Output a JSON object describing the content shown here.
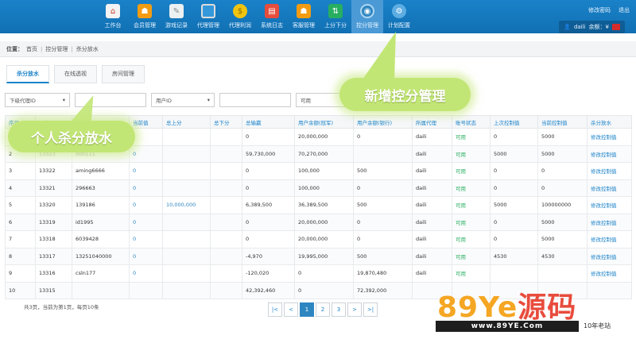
{
  "nav": {
    "items": [
      {
        "label": "工作台",
        "icon": "home-icon",
        "glyph": "⌂"
      },
      {
        "label": "会员管理",
        "icon": "users-icon",
        "glyph": "☗"
      },
      {
        "label": "游戏记录",
        "icon": "record-icon",
        "glyph": "✎"
      },
      {
        "label": "代理管理",
        "icon": "monitor-icon",
        "glyph": "▭"
      },
      {
        "label": "代理利润",
        "icon": "money-bag-icon",
        "glyph": "$"
      },
      {
        "label": "系统日志",
        "icon": "log-icon",
        "glyph": "▤"
      },
      {
        "label": "客服管理",
        "icon": "service-icon",
        "glyph": "☗"
      },
      {
        "label": "上分下分",
        "icon": "transfer-icon",
        "glyph": "⇅"
      },
      {
        "label": "控分管理",
        "icon": "control-icon",
        "glyph": "◉"
      },
      {
        "label": "计划配置",
        "icon": "config-icon",
        "glyph": "⚙"
      }
    ],
    "active_index": 8
  },
  "top_right": {
    "change_password": "修改密码",
    "logout": "退出"
  },
  "user": {
    "name": "daili",
    "balance_label": "余额：¥"
  },
  "breadcrumb": {
    "prefix": "位置：",
    "items": [
      "首页",
      "控分管理",
      "杀分放水"
    ]
  },
  "tabs": [
    "杀分放水",
    "在线透视",
    "房间管理"
  ],
  "filters": {
    "agent_select": "下级代理ID",
    "user_select": "用户ID",
    "status_select": "可用"
  },
  "table": {
    "headers": [
      "序号",
      "玩家ID",
      "玩家账号",
      "当前值",
      "总上分",
      "总下分",
      "总输赢",
      "用户余额(冠军)",
      "用户余额(银行)",
      "所属代理",
      "账号状态",
      "上次控制值",
      "当前控制值",
      "杀分放水"
    ],
    "rows": [
      [
        "1",
        "13324",
        "",
        "",
        "",
        "",
        "0",
        "20,000,000",
        "0",
        "daili",
        "可用",
        "0",
        "5000",
        "修改控制值"
      ],
      [
        "2",
        "13323",
        "000111",
        "0",
        "",
        "",
        "59,730,000",
        "70,270,000",
        "",
        "daili",
        "可用",
        "5000",
        "5000",
        "修改控制值"
      ],
      [
        "3",
        "13322",
        "aming6666",
        "0",
        "",
        "",
        "0",
        "100,000",
        "500",
        "daili",
        "可用",
        "0",
        "0",
        "修改控制值"
      ],
      [
        "4",
        "13321",
        "296663",
        "0",
        "",
        "",
        "0",
        "100,000",
        "0",
        "daili",
        "可用",
        "0",
        "0",
        "修改控制值"
      ],
      [
        "5",
        "13320",
        "139186",
        "0",
        "10,000,000",
        "",
        "6,389,500",
        "36,389,500",
        "500",
        "daili",
        "可用",
        "5000",
        "100000000",
        "修改控制值"
      ],
      [
        "6",
        "13319",
        "id1995",
        "0",
        "",
        "",
        "0",
        "20,000,000",
        "0",
        "daili",
        "可用",
        "0",
        "5000",
        "修改控制值"
      ],
      [
        "7",
        "13318",
        "6039428",
        "0",
        "",
        "",
        "0",
        "20,000,000",
        "0",
        "daili",
        "可用",
        "0",
        "5000",
        "修改控制值"
      ],
      [
        "8",
        "13317",
        "13251040000",
        "0",
        "",
        "",
        "-4,970",
        "19,995,000",
        "500",
        "daili",
        "可用",
        "4530",
        "4530",
        "修改控制值"
      ],
      [
        "9",
        "13316",
        "csln177",
        "0",
        "",
        "",
        "-120,020",
        "0",
        "19,870,480",
        "daili",
        "可用",
        "",
        "",
        "修改控制值"
      ],
      [
        "10",
        "13315",
        "",
        "",
        "",
        "",
        "42,392,460",
        "0",
        "72,392,000",
        "",
        "",
        "",
        "",
        ""
      ]
    ]
  },
  "pager": {
    "info": "共3页，当前为第1页，每页10条",
    "buttons": [
      "|<",
      "<",
      "1",
      "2",
      "3",
      ">",
      ">|"
    ],
    "current": "1"
  },
  "callouts": {
    "new_feature": "新增控分管理",
    "personal": "个人杀分放水"
  },
  "watermark": {
    "brand_a": "89Ye",
    "brand_b": "源码",
    "url": "www.89YE.Com",
    "tag": "10年老站"
  },
  "colors": {
    "nav_bg": "#1a82c9",
    "accent": "#1a82c9",
    "callout": "#c2e675",
    "status_green": "#27ae60"
  }
}
